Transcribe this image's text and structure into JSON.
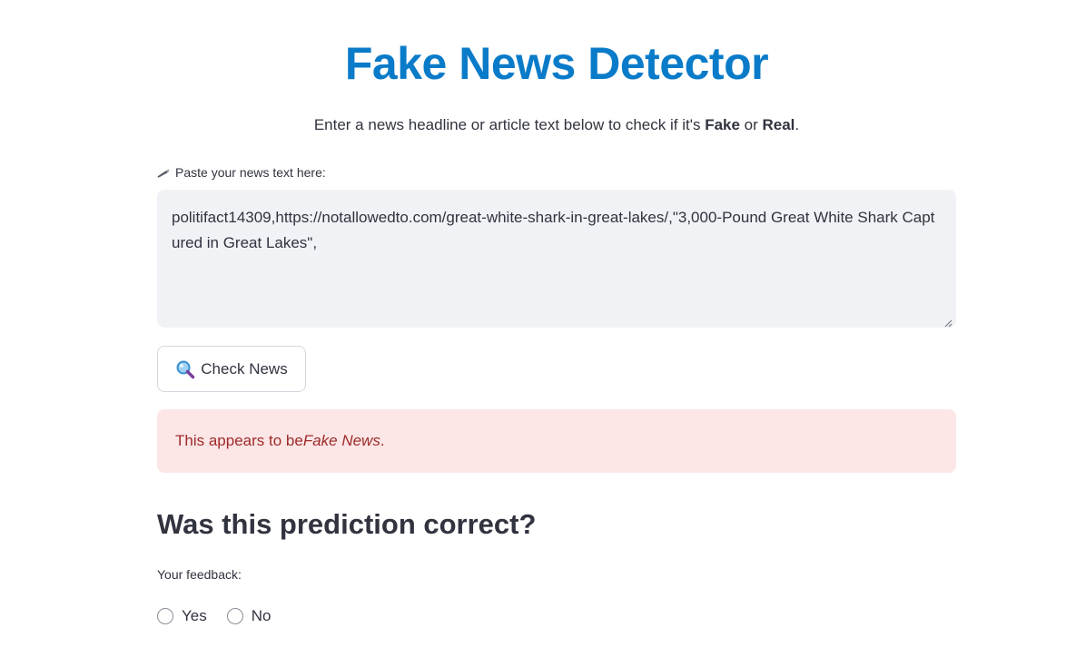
{
  "header": {
    "title": "Fake News Detector",
    "subtitle_prefix": "Enter a news headline or article text below to check if it's ",
    "subtitle_fake": "Fake",
    "subtitle_or": " or ",
    "subtitle_real": "Real",
    "subtitle_suffix": "."
  },
  "input": {
    "label": "Paste your news text here:",
    "icon": "pen-icon",
    "value": "politifact14309,https://notallowedto.com/great-white-shark-in-great-lakes/,\"3,000-Pound Great White Shark Captured in Great Lakes\","
  },
  "check_button": {
    "icon": "magnifier-icon",
    "label": "Check News"
  },
  "result": {
    "prefix": "This appears to be ",
    "emphasis": "Fake News",
    "suffix": ".",
    "color": "#9e2a2a",
    "background": "#fde6e6"
  },
  "feedback": {
    "heading": "Was this prediction correct?",
    "label": "Your feedback:",
    "options": [
      "Yes",
      "No"
    ]
  },
  "colors": {
    "title": "#0a7bc9",
    "text": "#31333f",
    "input_bg": "#f0f2f6"
  }
}
